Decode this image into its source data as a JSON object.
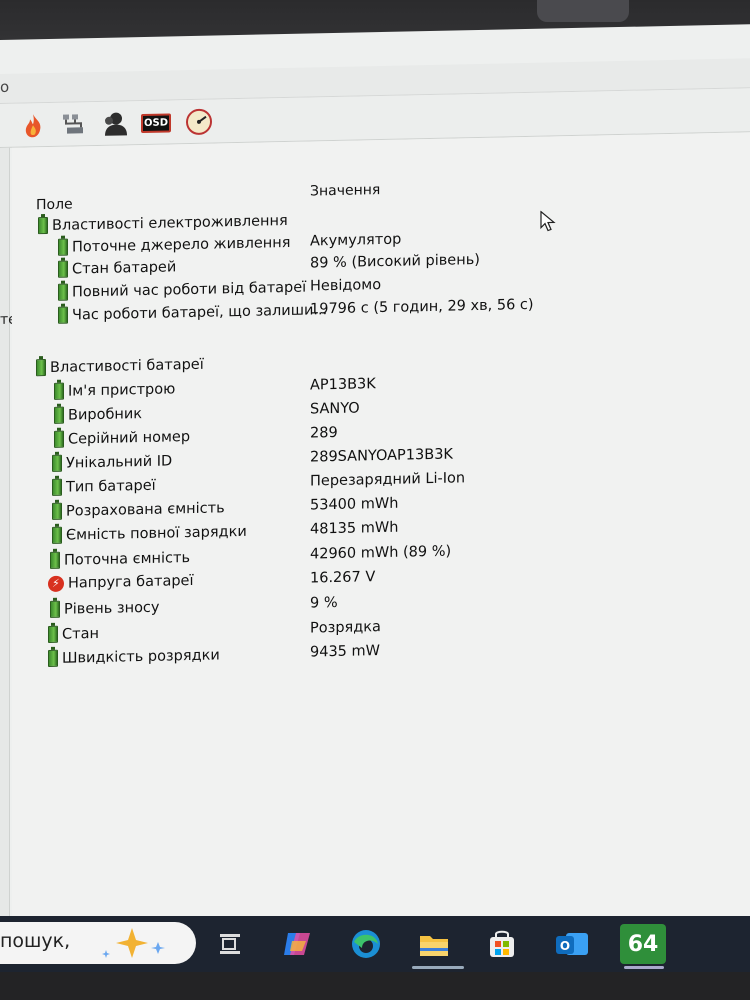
{
  "titlebar": {
    "mark": "o"
  },
  "toolbar": {
    "tools": [
      {
        "icon": "flame-icon"
      },
      {
        "icon": "network-icon"
      },
      {
        "icon": "user-icon"
      },
      {
        "icon": "osd-icon",
        "label": "OSD"
      },
      {
        "icon": "gauge-icon"
      }
    ]
  },
  "left_pane": {
    "stub_text": "тер"
  },
  "grid": {
    "headers": {
      "field": "Поле",
      "value": "Значення"
    },
    "sections": [
      {
        "title": "Властивості електроживлення",
        "rows": [
          {
            "name": "Поточне джерело живлення",
            "value": "Акумулятор"
          },
          {
            "name": "Стан батарей",
            "value": "89 % (Високий рівень)"
          },
          {
            "name": "Повний час роботи від батареї",
            "value": "Невідомо"
          },
          {
            "name": "Час роботи батареї, що залиши...",
            "value": "19796 с (5 годин, 29 хв, 56 с)"
          }
        ]
      },
      {
        "title": "Властивості батареї",
        "rows": [
          {
            "name": "Ім'я пристрою",
            "value": "AP13B3K"
          },
          {
            "name": "Виробник",
            "value": "SANYO"
          },
          {
            "name": "Серійний номер",
            "value": "289"
          },
          {
            "name": "Унікальний ID",
            "value": "289SANYOAP13B3K"
          },
          {
            "name": "Тип батареї",
            "value": "Перезарядний Li-Ion"
          },
          {
            "name": "Розрахована ємність",
            "value": "53400 mWh"
          },
          {
            "name": "Ємність повної зарядки",
            "value": "48135 mWh"
          },
          {
            "name": "Поточна ємність",
            "value": "42960 mWh  (89 %)"
          },
          {
            "name": "Напруга батареї",
            "value": "16.267 V",
            "icon": "voltage-icon"
          },
          {
            "name": "Рівень зносу",
            "value": "9 %"
          },
          {
            "name": "Стан",
            "value": "Розрядка"
          },
          {
            "name": "Швидкість розрядки",
            "value": "9435 mW"
          }
        ]
      }
    ]
  },
  "taskbar": {
    "search_text": "пошук,",
    "apps": [
      {
        "icon": "task-view-icon"
      },
      {
        "icon": "copilot-icon"
      },
      {
        "icon": "edge-icon"
      },
      {
        "icon": "file-explorer-icon"
      },
      {
        "icon": "store-icon"
      },
      {
        "icon": "outlook-icon"
      },
      {
        "icon": "aida64-icon",
        "label": "64"
      }
    ]
  },
  "colors": {
    "battery_green": "#4fa33a",
    "voltage_red": "#d8311f",
    "taskbar_bg": "#1d2430",
    "window_bg": "#f1f2f1"
  }
}
